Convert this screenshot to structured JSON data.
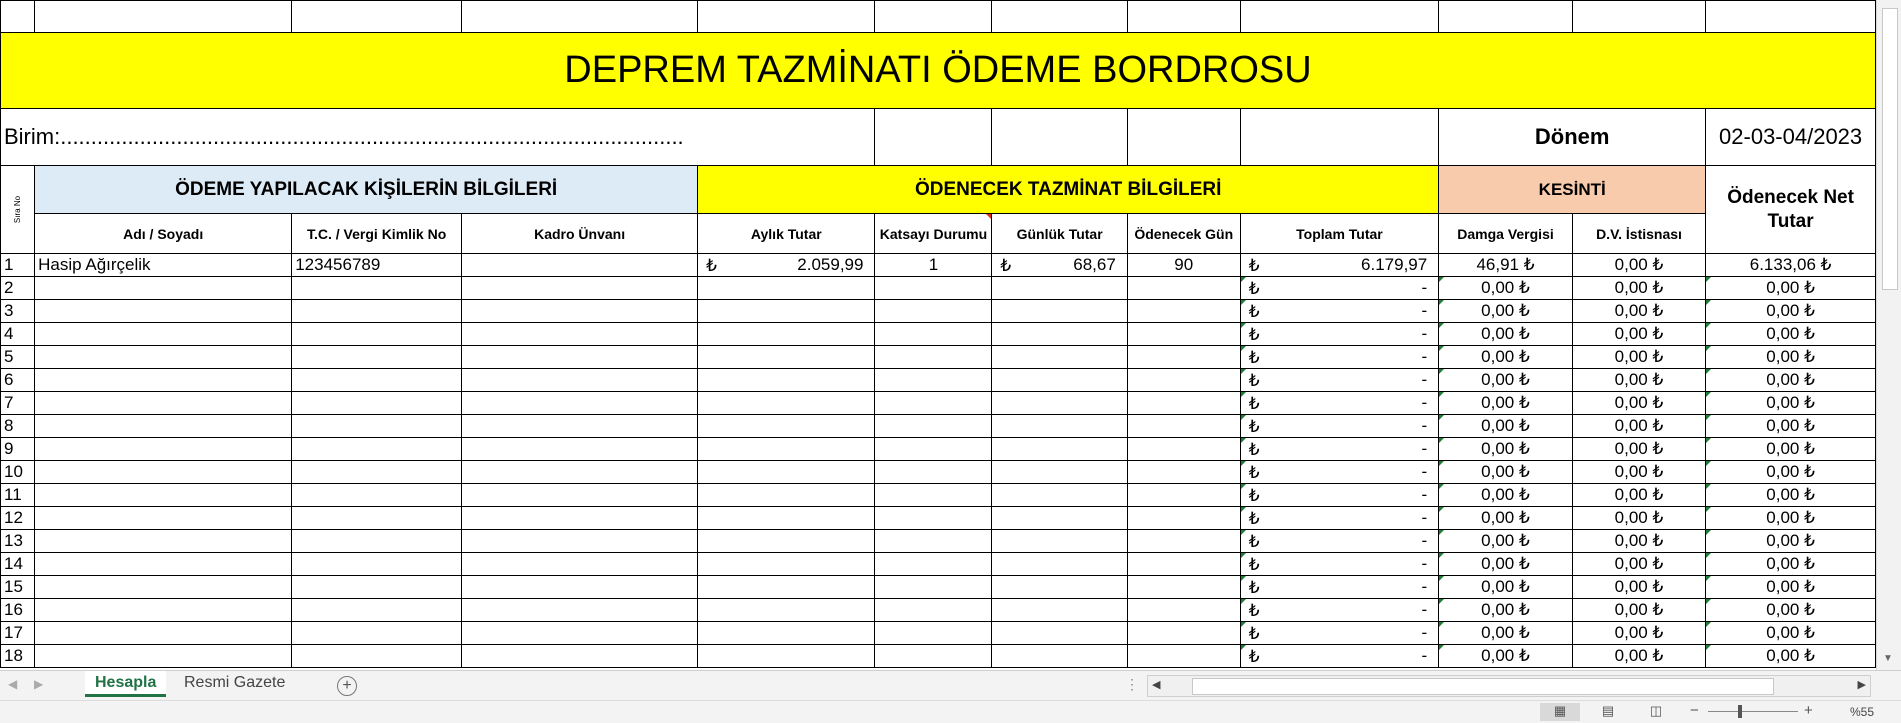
{
  "sheet": {
    "title": "DEPREM TAZMİNATI ÖDEME  BORDROSU",
    "birim": "Birim:......................................................................................................",
    "donem_label": "Dönem",
    "donem_value": "02-03-04/2023",
    "sira_no_label": "Sıra No",
    "sections": {
      "kisiler": "ÖDEME YAPILACAK KİŞİLERİN BİLGİLERİ",
      "tazminat": "ÖDENECEK TAZMİNAT BİLGİLERİ",
      "kesinti": "KESİNTİ",
      "net": "Ödenecek Net Tutar"
    },
    "columns": {
      "adi": "Adı / Soyadı",
      "tc": "T.C. / Vergi Kimlik No",
      "kadro": "Kadro Ünvanı",
      "aylik": "Aylık Tutar",
      "katsayi": "Katsayı Durumu",
      "gunluk": "Günlük Tutar",
      "gun": "Ödenecek Gün",
      "toplam": "Toplam Tutar",
      "damga": "Damga Vergisi",
      "dv": "D.V. İstisnası"
    },
    "currency_symbol": "₺",
    "rows": [
      {
        "no": "1",
        "name": "Hasip Ağırçelik",
        "tc": "123456789",
        "kadro": "",
        "aylik": "2.059,99",
        "katsayi": "1",
        "gunluk": "68,67",
        "gun": "90",
        "toplam": "6.179,97",
        "damga": "46,91 ₺",
        "dv": "0,00 ₺",
        "net": "6.133,06 ₺"
      },
      {
        "no": "2",
        "toplam": "-",
        "damga": "0,00 ₺",
        "dv": "0,00 ₺",
        "net": "0,00 ₺"
      },
      {
        "no": "3",
        "toplam": "-",
        "damga": "0,00 ₺",
        "dv": "0,00 ₺",
        "net": "0,00 ₺"
      },
      {
        "no": "4",
        "toplam": "-",
        "damga": "0,00 ₺",
        "dv": "0,00 ₺",
        "net": "0,00 ₺"
      },
      {
        "no": "5",
        "toplam": "-",
        "damga": "0,00 ₺",
        "dv": "0,00 ₺",
        "net": "0,00 ₺"
      },
      {
        "no": "6",
        "toplam": "-",
        "damga": "0,00 ₺",
        "dv": "0,00 ₺",
        "net": "0,00 ₺"
      },
      {
        "no": "7",
        "toplam": "-",
        "damga": "0,00 ₺",
        "dv": "0,00 ₺",
        "net": "0,00 ₺"
      },
      {
        "no": "8",
        "toplam": "-",
        "damga": "0,00 ₺",
        "dv": "0,00 ₺",
        "net": "0,00 ₺"
      },
      {
        "no": "9",
        "toplam": "-",
        "damga": "0,00 ₺",
        "dv": "0,00 ₺",
        "net": "0,00 ₺"
      },
      {
        "no": "10",
        "toplam": "-",
        "damga": "0,00 ₺",
        "dv": "0,00 ₺",
        "net": "0,00 ₺"
      },
      {
        "no": "11",
        "toplam": "-",
        "damga": "0,00 ₺",
        "dv": "0,00 ₺",
        "net": "0,00 ₺"
      },
      {
        "no": "12",
        "toplam": "-",
        "damga": "0,00 ₺",
        "dv": "0,00 ₺",
        "net": "0,00 ₺"
      },
      {
        "no": "13",
        "toplam": "-",
        "damga": "0,00 ₺",
        "dv": "0,00 ₺",
        "net": "0,00 ₺"
      },
      {
        "no": "14",
        "toplam": "-",
        "damga": "0,00 ₺",
        "dv": "0,00 ₺",
        "net": "0,00 ₺"
      },
      {
        "no": "15",
        "toplam": "-",
        "damga": "0,00 ₺",
        "dv": "0,00 ₺",
        "net": "0,00 ₺"
      },
      {
        "no": "16",
        "toplam": "-",
        "damga": "0,00 ₺",
        "dv": "0,00 ₺",
        "net": "0,00 ₺"
      },
      {
        "no": "17",
        "toplam": "-",
        "damga": "0,00 ₺",
        "dv": "0,00 ₺",
        "net": "0,00 ₺"
      },
      {
        "no": "18",
        "toplam": "-",
        "damga": "0,00 ₺",
        "dv": "0,00 ₺",
        "net": "0,00 ₺"
      }
    ]
  },
  "tabs": [
    {
      "label": "Hesapla",
      "active": true
    },
    {
      "label": "Resmi Gazete",
      "active": false
    }
  ],
  "status": {
    "zoom": "%55"
  },
  "icons": [
    "add-sheet-icon",
    "scroll-left-icon",
    "scroll-right-icon",
    "normal-view-icon",
    "page-layout-view-icon",
    "page-break-view-icon"
  ],
  "colors": {
    "title_bg": "#ffff00",
    "kisiler_bg": "#ddebf7",
    "kesinti_bg": "#f8cbad",
    "active_tab": "#217346"
  }
}
